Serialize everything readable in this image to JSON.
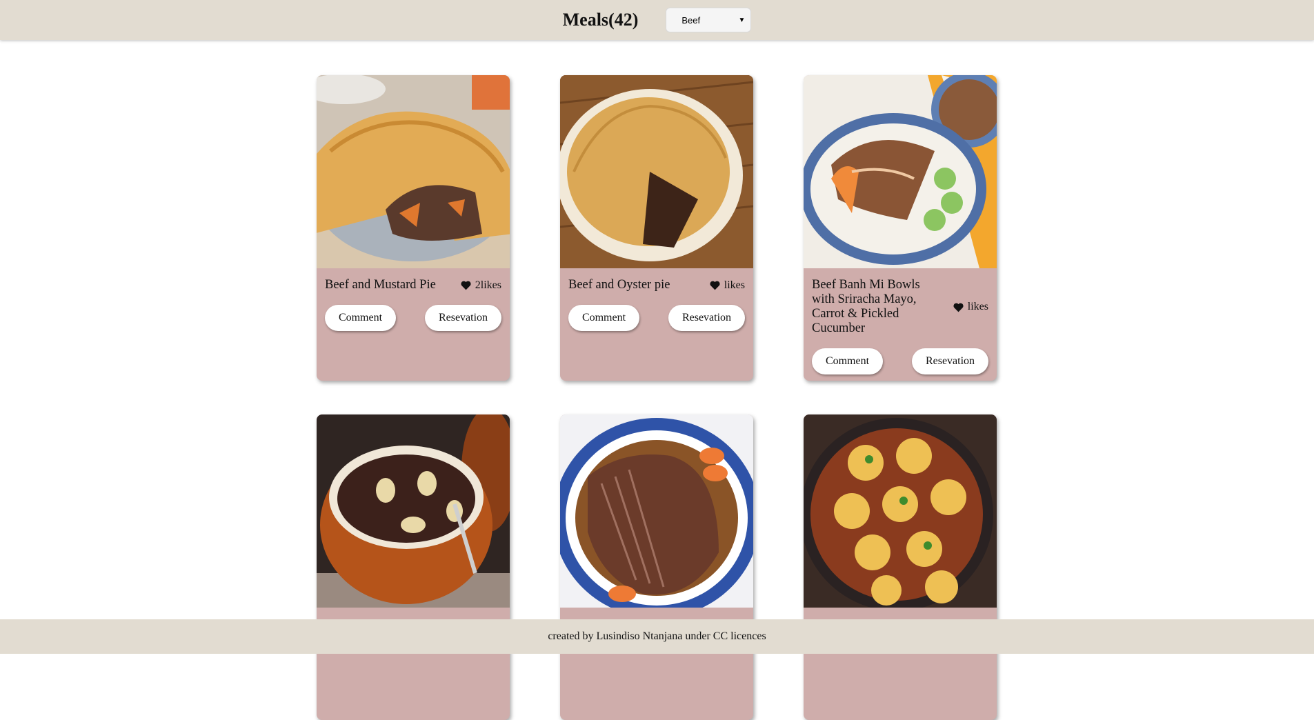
{
  "header": {
    "title": "Meals(42)",
    "category_select": "Beef"
  },
  "cards": [
    {
      "name": "Beef and Mustard Pie",
      "likes": "2likes",
      "comment": "Comment",
      "reservation": "Resevation"
    },
    {
      "name": "Beef and Oyster pie",
      "likes": "likes",
      "comment": "Comment",
      "reservation": "Resevation"
    },
    {
      "name": "Beef Banh Mi Bowls with Sriracha Mayo, Carrot & Pickled Cucumber",
      "likes": "likes",
      "comment": "Comment",
      "reservation": "Resevation"
    }
  ],
  "footer": {
    "text": "created by Lusindiso Ntanjana under CC licences"
  },
  "colors": {
    "header_bg": "#e2dcd1",
    "card_bg": "#cfadab",
    "heart": "#111111"
  }
}
